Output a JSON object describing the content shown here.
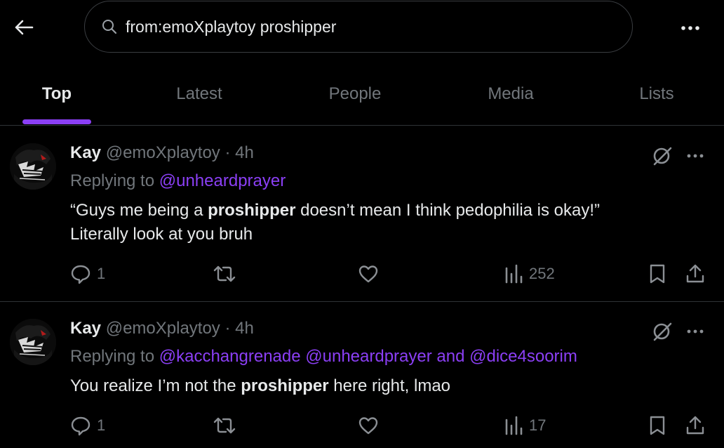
{
  "search": {
    "query": "from:emoXplaytoy proshipper"
  },
  "tabs": [
    {
      "label": "Top"
    },
    {
      "label": "Latest"
    },
    {
      "label": "People"
    },
    {
      "label": "Media"
    },
    {
      "label": "Lists"
    }
  ],
  "accent_color": "#8b3ff5",
  "tweets": [
    {
      "name": "Kay",
      "handle": "@emoXplaytoy",
      "separator": "·",
      "time": "4h",
      "replying_prefix": "Replying to",
      "mentions": [
        "@unheardprayer"
      ],
      "and_word": "",
      "body_pre": "“Guys me being a ",
      "body_bold": "proshipper",
      "body_post": " doesn’t mean I think pedophilia is okay!”",
      "body_line2": "Literally look at you bruh",
      "replies": "1",
      "reposts": "",
      "likes": "",
      "views": "252"
    },
    {
      "name": "Kay",
      "handle": "@emoXplaytoy",
      "separator": "·",
      "time": "4h",
      "replying_prefix": "Replying to",
      "mentions": [
        "@kacchangrenade",
        "@unheardprayer",
        "@dice4soorim"
      ],
      "and_word": "and",
      "body_pre": "You realize I’m not the ",
      "body_bold": "proshipper",
      "body_post": " here right, lmao",
      "body_line2": "",
      "replies": "1",
      "reposts": "",
      "likes": "",
      "views": "17"
    }
  ]
}
